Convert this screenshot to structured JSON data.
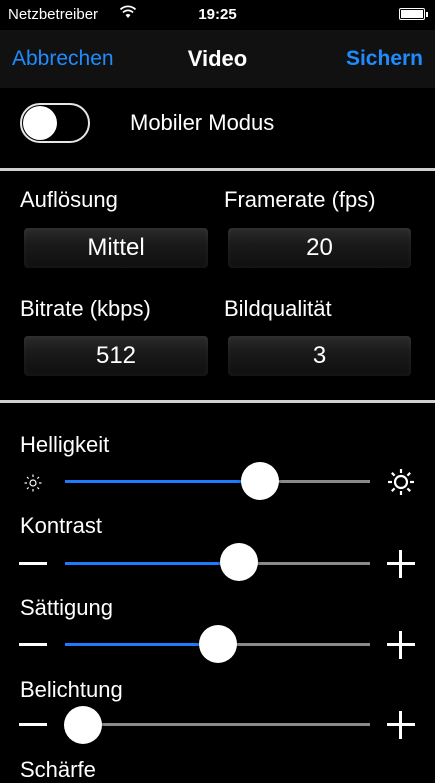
{
  "status": {
    "carrier": "Netzbetreiber",
    "time": "19:25"
  },
  "nav": {
    "cancel": "Abbrechen",
    "title": "Video",
    "save": "Sichern"
  },
  "mobile_mode": {
    "label": "Mobiler Modus",
    "enabled": false
  },
  "settings": {
    "resolution": {
      "label": "Auflösung",
      "value": "Mittel"
    },
    "framerate": {
      "label": "Framerate (fps)",
      "value": "20"
    },
    "bitrate": {
      "label": "Bitrate (kbps)",
      "value": "512"
    },
    "quality": {
      "label": "Bildqualität",
      "value": "3"
    }
  },
  "sliders": [
    {
      "label": "Helligkeit",
      "level": 0.64,
      "min_icon": "sun-small-icon",
      "max_icon": "sun-large-icon"
    },
    {
      "label": "Kontrast",
      "level": 0.57,
      "min_icon": "minus-icon",
      "max_icon": "plus-icon"
    },
    {
      "label": "Sättigung",
      "level": 0.5,
      "min_icon": "minus-icon",
      "max_icon": "plus-icon"
    },
    {
      "label": "Belichtung",
      "level": 0.06,
      "min_icon": "minus-icon",
      "max_icon": "plus-icon"
    }
  ],
  "partial_label": "Schärfe",
  "colors": {
    "accent": "#1e8cff",
    "slider_fill": "#1e7bff",
    "background": "#000000"
  }
}
